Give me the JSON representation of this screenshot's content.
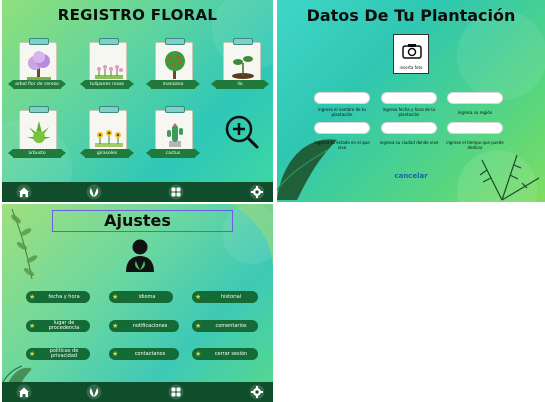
{
  "registro": {
    "title": "REGISTRO FLORAL",
    "plants": [
      {
        "label": "arbol flor de cerezo"
      },
      {
        "label": "tulipanes rosas"
      },
      {
        "label": "manzano"
      },
      {
        "label": "ilo"
      },
      {
        "label": "arbusto"
      },
      {
        "label": "girasoles"
      },
      {
        "label": "cactus"
      }
    ],
    "add_icon": "magnifier-plus-icon"
  },
  "datos": {
    "title": "Datos De Tu Plantación",
    "photo_label": "inserta foto",
    "fields": [
      {
        "label": "ingresa el nombre de tu plantación"
      },
      {
        "label": "ingresa fecha y hora de tu plantación"
      },
      {
        "label": "ingresa su región"
      },
      {
        "label": "ingresa su estado en el que vive"
      },
      {
        "label": "ingresa su ciudad donde vive"
      },
      {
        "label": "ingresa el tiempo que puede dedicar"
      }
    ],
    "cancel": "cancelar"
  },
  "ajustes": {
    "title": "Ajustes",
    "buttons": [
      {
        "label": "fecha y hora"
      },
      {
        "label": "idioma"
      },
      {
        "label": "historial"
      },
      {
        "label": "lugar de procedencia"
      },
      {
        "label": "notificaciones"
      },
      {
        "label": "comentarios"
      },
      {
        "label": "politicas de privacidad"
      },
      {
        "label": "contactanos"
      },
      {
        "label": "cerrar sesión"
      }
    ]
  },
  "navbar": {
    "icons": [
      "home-icon",
      "leaves-icon",
      "grid-icon",
      "gear-icon"
    ]
  },
  "colors": {
    "nav": "#0f4d2b",
    "button": "#146b35",
    "banner": "#1f7a3c",
    "cancel": "#1d5fb0"
  }
}
